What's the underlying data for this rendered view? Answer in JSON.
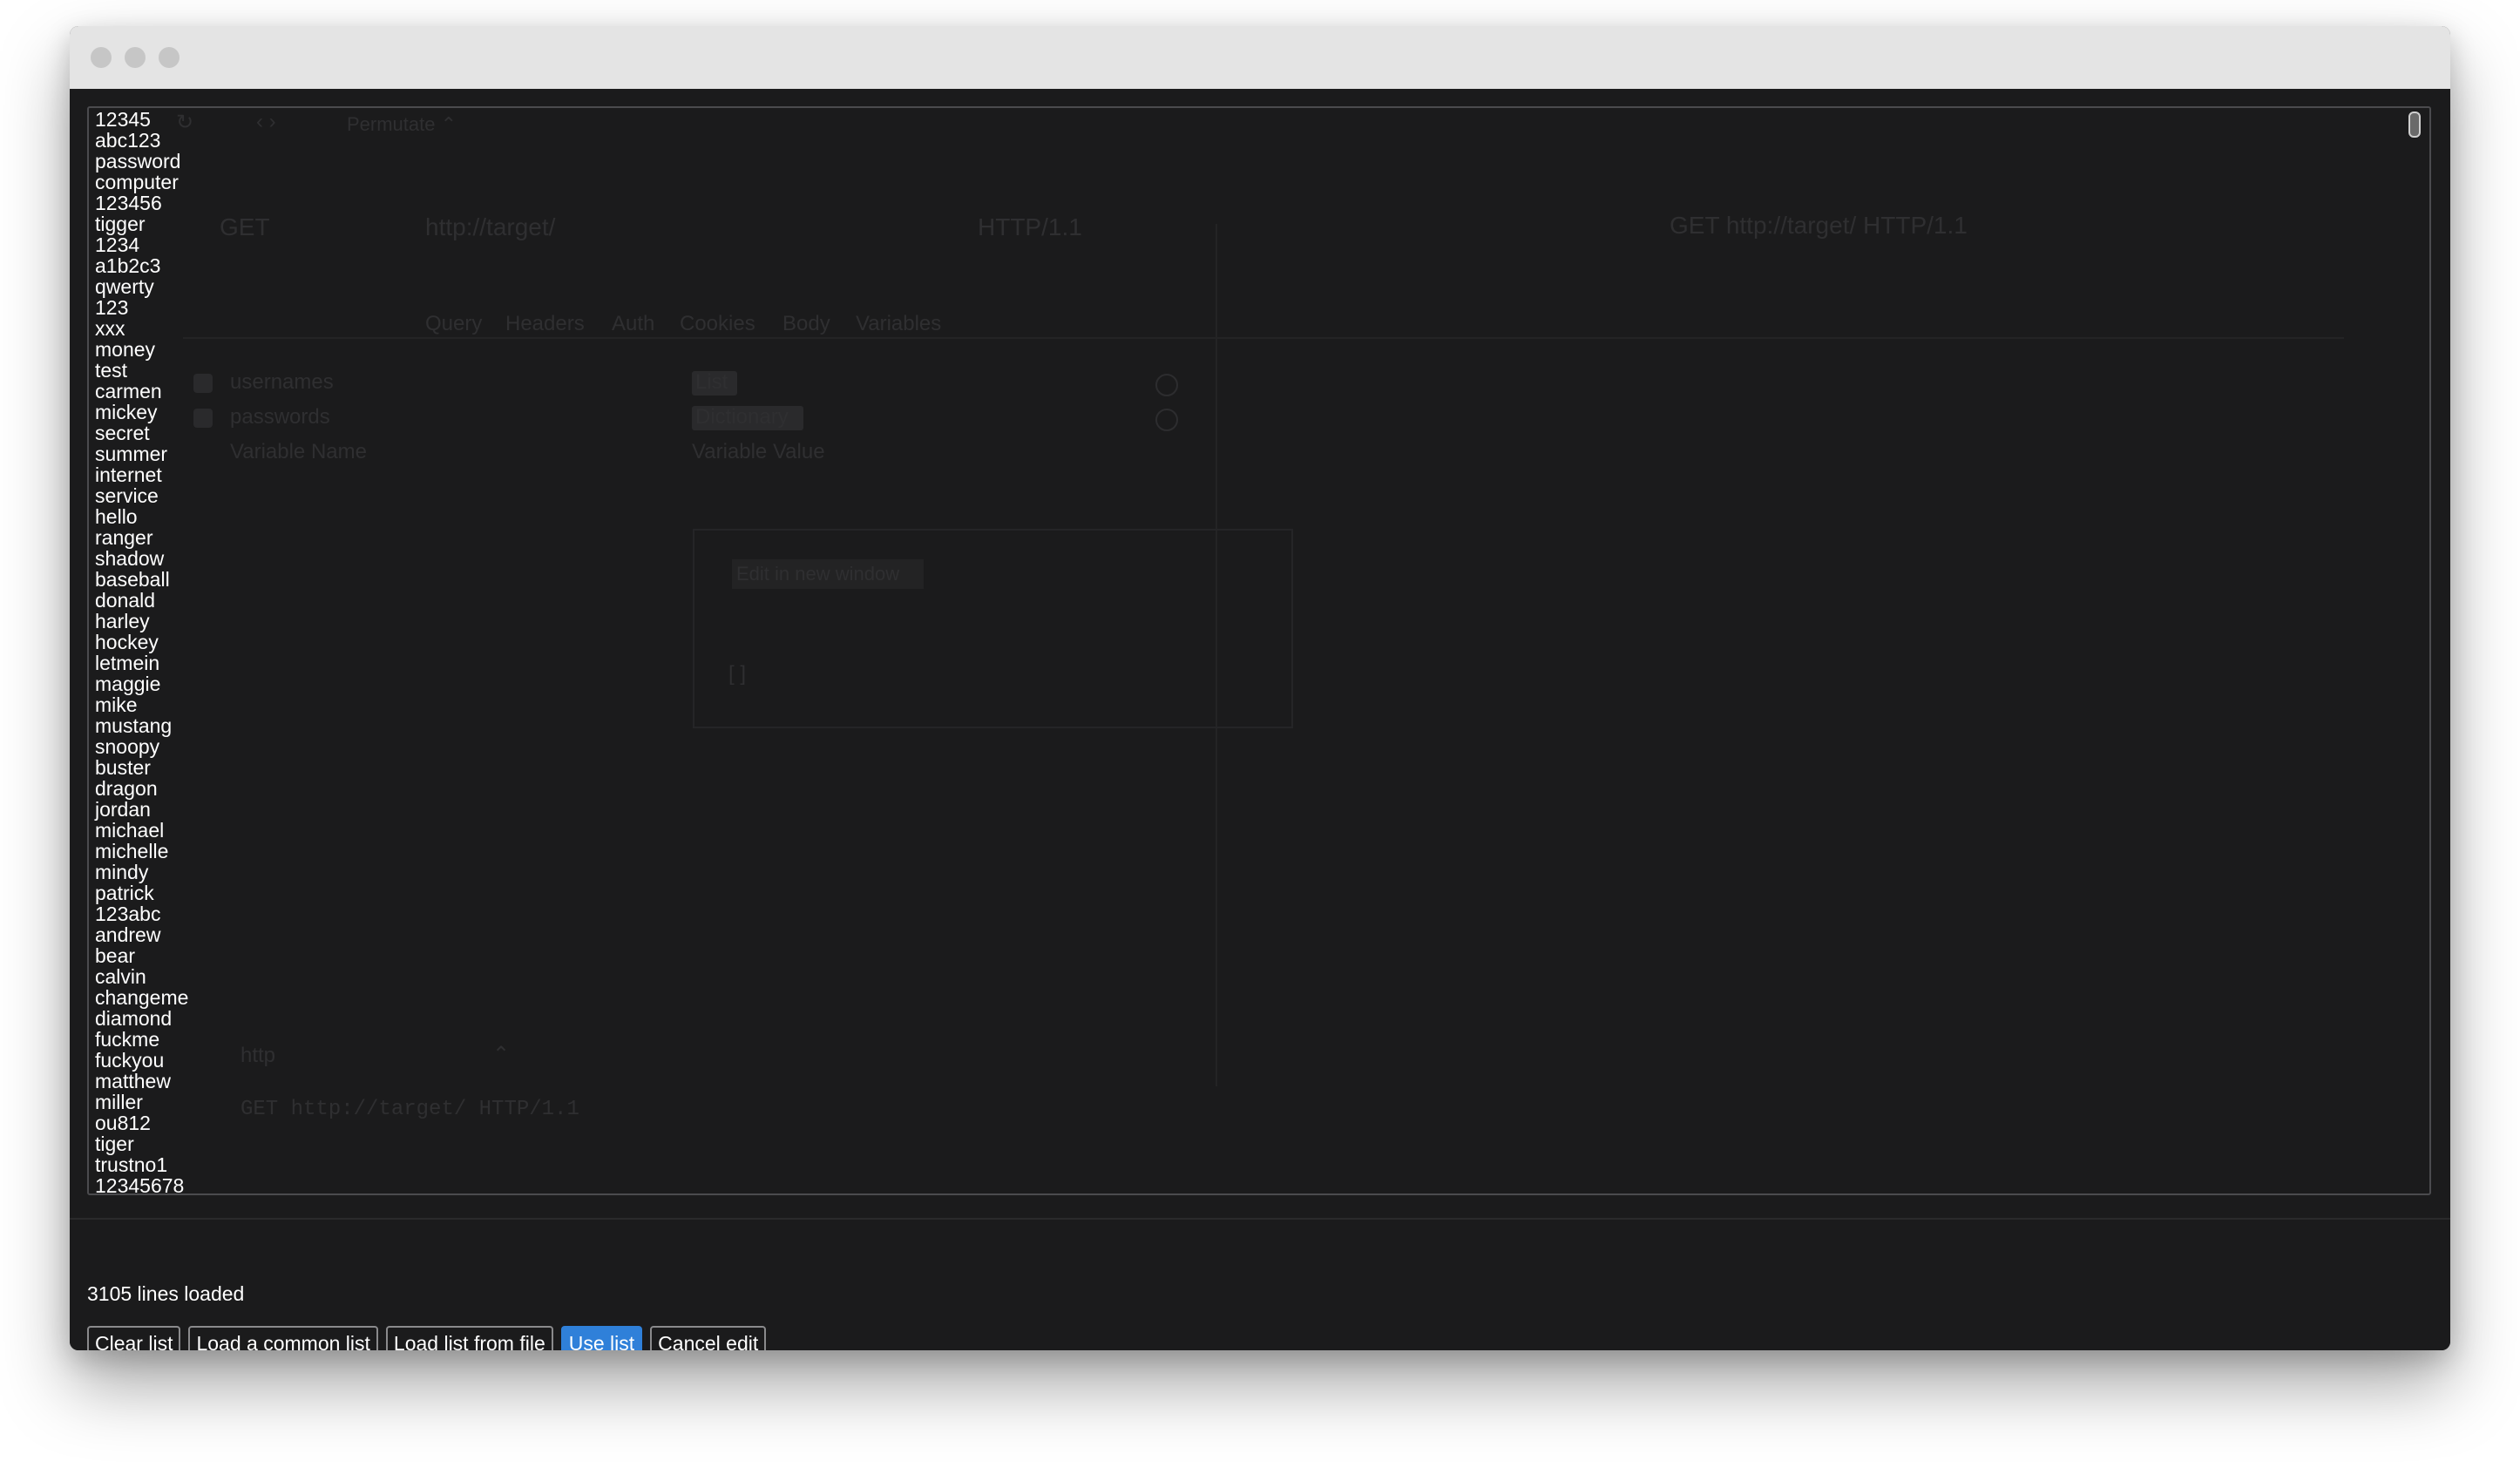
{
  "editor": {
    "lines": [
      "12345",
      "abc123",
      "password",
      "computer",
      "123456",
      "tigger",
      "1234",
      "a1b2c3",
      "qwerty",
      "123",
      "xxx",
      "money",
      "test",
      "carmen",
      "mickey",
      "secret",
      "summer",
      "internet",
      "service",
      "hello",
      "ranger",
      "shadow",
      "baseball",
      "donald",
      "harley",
      "hockey",
      "letmein",
      "maggie",
      "mike",
      "mustang",
      "snoopy",
      "buster",
      "dragon",
      "jordan",
      "michael",
      "michelle",
      "mindy",
      "patrick",
      "123abc",
      "andrew",
      "bear",
      "calvin",
      "changeme",
      "diamond",
      "fuckme",
      "fuckyou",
      "matthew",
      "miller",
      "ou812",
      "tiger",
      "trustno1",
      "12345678"
    ]
  },
  "background": {
    "toolbar_mode": "Permutate ⌃",
    "method": "GET",
    "url": "http://target/",
    "protocol": "HTTP/1.1",
    "preview_line": "GET http://target/ HTTP/1.1",
    "tabs": [
      "Query",
      "Headers",
      "Auth",
      "Cookies",
      "Body",
      "Variables"
    ],
    "variables": [
      {
        "name": "usernames",
        "type": "List"
      },
      {
        "name": "passwords",
        "type": "Dictionary"
      }
    ],
    "variable_name_placeholder": "Variable Name",
    "variable_value_placeholder": "Variable Value",
    "panel_button": "Edit in new window",
    "panel_brackets": "[ ]",
    "scheme_select": "http",
    "raw_request": "GET http://target/ HTTP/1.1"
  },
  "footer": {
    "status": "3105 lines loaded",
    "buttons": {
      "clear": "Clear list",
      "load_common": "Load a common list",
      "load_file": "Load list from file",
      "use": "Use list",
      "cancel": "Cancel edit"
    }
  },
  "colors": {
    "primary_button": "#2f80d9",
    "background": "#1b1b1c",
    "titlebar": "#e4e4e4"
  }
}
